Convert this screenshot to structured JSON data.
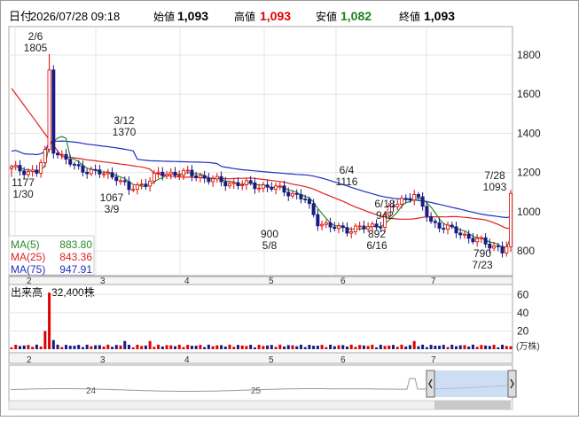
{
  "header": {
    "date_label": "日付",
    "datetime": "2026/07/28 09:18",
    "open_label": "始値",
    "open_value": "1,093",
    "high_label": "高値",
    "high_value": "1,093",
    "low_label": "安値",
    "low_value": "1,082",
    "close_label": "終値",
    "close_value": "1,093"
  },
  "colors": {
    "up": "#e00000",
    "down": "#1a1a80",
    "ma5": "#2a8a2a",
    "ma25": "#e02020",
    "ma75": "#2030c0",
    "volume_up": "#e00000",
    "volume_down": "#1a1a80",
    "price_high": "#e00000",
    "price_low": "#208020"
  },
  "legend": [
    {
      "name": "MA(5)",
      "value": "883.80",
      "color": "#2a8a2a"
    },
    {
      "name": "MA(25)",
      "value": "843.36",
      "color": "#e02020"
    },
    {
      "name": "MA(75)",
      "value": "947.91",
      "color": "#2030c0"
    }
  ],
  "volume_header": {
    "label": "出来高",
    "value": "32,400株"
  },
  "volume_unit": "(万株)",
  "navigator_labels": [
    "24",
    "25"
  ],
  "annotations": [
    {
      "date": "2/6",
      "value": "1805"
    },
    {
      "date": "1/30",
      "value": "1177"
    },
    {
      "date": "3/12",
      "value": "1370"
    },
    {
      "date": "3/9",
      "value": "1067"
    },
    {
      "date": "6/4",
      "value": "1116"
    },
    {
      "date": "5/8",
      "value": "900"
    },
    {
      "date": "6/18",
      "value": "942"
    },
    {
      "date": "6/16",
      "value": "892"
    },
    {
      "date": "7/28",
      "value": "1093"
    },
    {
      "date": "7/23",
      "value": "790"
    }
  ],
  "chart_data": {
    "type": "candlestick",
    "x_axis": {
      "tick_labels": [
        "2",
        "3",
        "4",
        "5",
        "6",
        "7"
      ]
    },
    "y_axis": {
      "tick_labels": [
        "800",
        "1000",
        "1200",
        "1400",
        "1600",
        "1800"
      ],
      "range": [
        700,
        1950
      ]
    },
    "volume_axis": {
      "tick_labels": [
        "20",
        "40",
        "60"
      ],
      "range": [
        0,
        70
      ],
      "unit": "万株"
    },
    "points": [
      {
        "label": "1/30",
        "low": 1177,
        "date_index": 0
      },
      {
        "label": "2/6",
        "high": 1805
      },
      {
        "label": "3/9",
        "low": 1067
      },
      {
        "label": "3/12",
        "high": 1370
      },
      {
        "label": "5/8",
        "low": 900
      },
      {
        "label": "6/4",
        "high": 1116
      },
      {
        "label": "6/16",
        "low": 892
      },
      {
        "label": "6/18",
        "high": 942
      },
      {
        "label": "7/23",
        "low": 790
      },
      {
        "label": "7/28",
        "open": 1093,
        "high": 1093,
        "low": 1082,
        "close": 1093
      }
    ],
    "ma_last": {
      "MA(5)": 883.8,
      "MA(25)": 843.36,
      "MA(75)": 947.91
    },
    "volume_last": 32400,
    "grid": true
  }
}
